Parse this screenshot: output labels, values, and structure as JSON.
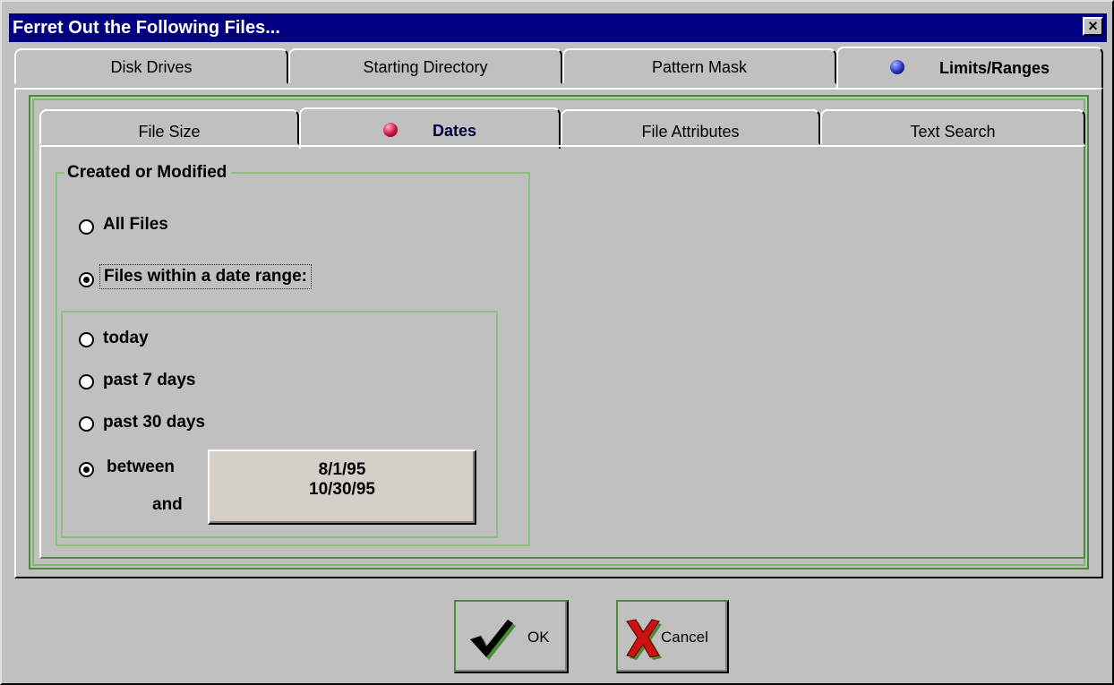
{
  "window": {
    "title": "Ferret Out the Following Files...",
    "close_glyph": "×"
  },
  "outer_tabs": [
    {
      "label": "Disk Drives"
    },
    {
      "label": "Starting Directory"
    },
    {
      "label": "Pattern Mask"
    },
    {
      "label": "Limits/Ranges",
      "active": true,
      "icon": "blue-ball-icon"
    }
  ],
  "inner_tabs": [
    {
      "label": "File Size"
    },
    {
      "label": "Dates",
      "active": true,
      "icon": "red-ball-icon"
    },
    {
      "label": "File Attributes"
    },
    {
      "label": "Text Search"
    }
  ],
  "group": {
    "title": "Created or Modified",
    "options": [
      {
        "label": "All Files",
        "selected": false
      },
      {
        "label": "Files within a date range:",
        "selected": true
      }
    ],
    "range_options": [
      {
        "label": "today",
        "selected": false
      },
      {
        "label": "past 7 days",
        "selected": false
      },
      {
        "label": "past 30 days",
        "selected": false
      },
      {
        "label": "between",
        "selected": true
      }
    ],
    "and_label": "and",
    "date_from": "8/1/95",
    "date_to": "10/30/95"
  },
  "buttons": {
    "ok": "OK",
    "cancel": "Cancel"
  },
  "colors": {
    "titlebar": "#000080",
    "accent_green": "#4a8c3a",
    "date_button_bg": "#d4d0c8"
  }
}
